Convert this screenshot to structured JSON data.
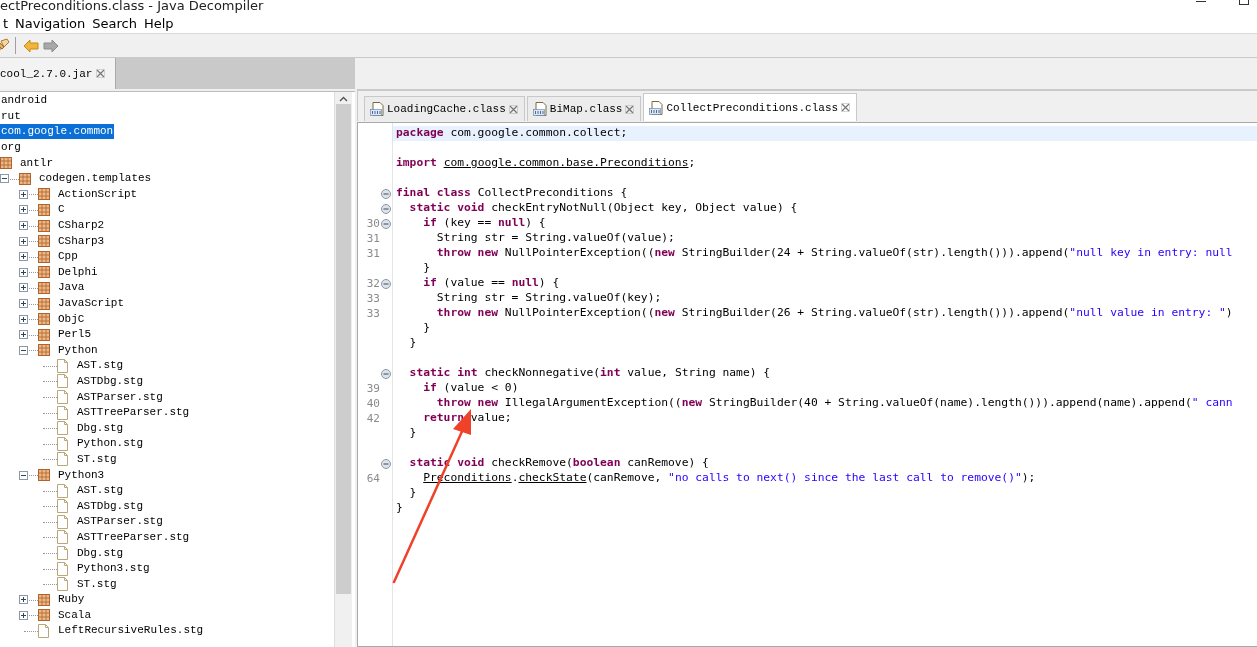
{
  "window": {
    "title": "ectPreconditions.class - Java Decompiler"
  },
  "menu": [
    "t",
    "Navigation",
    "Search",
    "Help"
  ],
  "toolbar": [
    {
      "kind": "open"
    },
    {
      "kind": "back",
      "disabled": false
    },
    {
      "kind": "forward",
      "disabled": true
    }
  ],
  "left_tabs": [
    {
      "label": "cool_2.7.0.jar",
      "selected": true
    }
  ],
  "tree": [
    {
      "label": "android",
      "selected": false
    },
    {
      "label": "rut",
      "selected": false
    },
    {
      "label": "com.google.common",
      "selected": true
    },
    {
      "label": "org",
      "selected": false,
      "children": [
        {
          "label": "antlr",
          "kind": "package",
          "selected": false,
          "children": [
            {
              "label": "codegen.templates",
              "kind": "package",
              "expanded": true,
              "selected": false,
              "children": [
                {
                  "label": "ActionScript",
                  "kind": "package",
                  "expanded": false,
                  "selected": false
                },
                {
                  "label": "C",
                  "kind": "package",
                  "expanded": false,
                  "selected": false
                },
                {
                  "label": "CSharp2",
                  "kind": "package",
                  "expanded": false,
                  "selected": false
                },
                {
                  "label": "CSharp3",
                  "kind": "package",
                  "expanded": false,
                  "selected": false
                },
                {
                  "label": "Cpp",
                  "kind": "package",
                  "expanded": false,
                  "selected": false
                },
                {
                  "label": "Delphi",
                  "kind": "package",
                  "expanded": false,
                  "selected": false
                },
                {
                  "label": "Java",
                  "kind": "package",
                  "expanded": false,
                  "selected": false
                },
                {
                  "label": "JavaScript",
                  "kind": "package",
                  "expanded": false,
                  "selected": false
                },
                {
                  "label": "ObjC",
                  "kind": "package",
                  "expanded": false,
                  "selected": false
                },
                {
                  "label": "Perl5",
                  "kind": "package",
                  "expanded": false,
                  "selected": false
                },
                {
                  "label": "Python",
                  "kind": "package",
                  "expanded": true,
                  "selected": false,
                  "children": [
                    {
                      "label": "AST.stg",
                      "kind": "file",
                      "selected": false
                    },
                    {
                      "label": "ASTDbg.stg",
                      "kind": "file",
                      "selected": false
                    },
                    {
                      "label": "ASTParser.stg",
                      "kind": "file",
                      "selected": false
                    },
                    {
                      "label": "ASTTreeParser.stg",
                      "kind": "file",
                      "selected": false
                    },
                    {
                      "label": "Dbg.stg",
                      "kind": "file",
                      "selected": false
                    },
                    {
                      "label": "Python.stg",
                      "kind": "file",
                      "selected": false
                    },
                    {
                      "label": "ST.stg",
                      "kind": "file",
                      "selected": false
                    }
                  ]
                },
                {
                  "label": "Python3",
                  "kind": "package",
                  "expanded": true,
                  "selected": false,
                  "children": [
                    {
                      "label": "AST.stg",
                      "kind": "file",
                      "selected": false
                    },
                    {
                      "label": "ASTDbg.stg",
                      "kind": "file",
                      "selected": false
                    },
                    {
                      "label": "ASTParser.stg",
                      "kind": "file",
                      "selected": false
                    },
                    {
                      "label": "ASTTreeParser.stg",
                      "kind": "file",
                      "selected": false
                    },
                    {
                      "label": "Dbg.stg",
                      "kind": "file",
                      "selected": false
                    },
                    {
                      "label": "Python3.stg",
                      "kind": "file",
                      "selected": false
                    },
                    {
                      "label": "ST.stg",
                      "kind": "file",
                      "selected": false
                    }
                  ]
                },
                {
                  "label": "Ruby",
                  "kind": "package",
                  "expanded": false,
                  "selected": false
                },
                {
                  "label": "Scala",
                  "kind": "package",
                  "expanded": false,
                  "selected": false
                },
                {
                  "label": "LeftRecursiveRules.stg",
                  "kind": "file",
                  "selected": false
                }
              ]
            }
          ]
        }
      ]
    }
  ],
  "editor_tabs": [
    {
      "label": "LoadingCache.class",
      "selected": false
    },
    {
      "label": "BiMap.class",
      "selected": false
    },
    {
      "label": "CollectPreconditions.class",
      "selected": true
    }
  ],
  "code": [
    {
      "highlighted": true,
      "segments": [
        {
          "kind": "keyword",
          "text": "package"
        },
        {
          "kind": "plain",
          "text": " com.google.common.collect;"
        }
      ]
    },
    {
      "blank_before": true,
      "segments": [
        {
          "kind": "keyword",
          "text": "import"
        },
        {
          "kind": "link",
          "text": " com.google.common.base.Preconditions"
        },
        {
          "kind": "plain",
          "text": ";"
        }
      ]
    },
    {
      "blank_before": true,
      "fold": true,
      "segments": [
        {
          "kind": "keyword",
          "text": "final class"
        },
        {
          "kind": "plain",
          "text": " CollectPreconditions {"
        }
      ]
    },
    {
      "fold": true,
      "segments": [
        {
          "kind": "keyword",
          "text": "  static void"
        },
        {
          "kind": "plain",
          "text": " checkEntryNotNull(Object key, Object value) {"
        }
      ]
    },
    {
      "number": "30",
      "fold": true,
      "segments": [
        {
          "kind": "keyword",
          "text": "    if"
        },
        {
          "kind": "plain",
          "text": " (key == "
        },
        {
          "kind": "keyword",
          "text": "null"
        },
        {
          "kind": "plain",
          "text": ") {"
        }
      ]
    },
    {
      "number": "31",
      "segments": [
        {
          "kind": "plain",
          "text": "      String str = String.valueOf(value);"
        }
      ]
    },
    {
      "number": "31",
      "segments": [
        {
          "kind": "keyword",
          "text": "      throw new"
        },
        {
          "kind": "plain",
          "text": " NullPointerException(("
        },
        {
          "kind": "keyword",
          "text": "new"
        },
        {
          "kind": "plain",
          "text": " StringBuilder(24 + String.valueOf(str).length())).append("
        },
        {
          "kind": "string",
          "text": "\"null key in entry: null"
        }
      ]
    },
    {
      "segments": [
        {
          "kind": "plain",
          "text": "    }"
        }
      ]
    },
    {
      "number": "32",
      "fold": true,
      "segments": [
        {
          "kind": "keyword",
          "text": "    if"
        },
        {
          "kind": "plain",
          "text": " (value == "
        },
        {
          "kind": "keyword",
          "text": "null"
        },
        {
          "kind": "plain",
          "text": ") {"
        }
      ]
    },
    {
      "number": "33",
      "segments": [
        {
          "kind": "plain",
          "text": "      String str = String.valueOf(key);"
        }
      ]
    },
    {
      "number": "33",
      "segments": [
        {
          "kind": "keyword",
          "text": "      throw new"
        },
        {
          "kind": "plain",
          "text": " NullPointerException(("
        },
        {
          "kind": "keyword",
          "text": "new"
        },
        {
          "kind": "plain",
          "text": " StringBuilder(26 + String.valueOf(str).length())).append("
        },
        {
          "kind": "string",
          "text": "\"null value in entry: \""
        },
        {
          "kind": "plain",
          "text": ")"
        }
      ]
    },
    {
      "segments": [
        {
          "kind": "plain",
          "text": "    }"
        }
      ]
    },
    {
      "segments": [
        {
          "kind": "plain",
          "text": "  }"
        }
      ]
    },
    {
      "blank_before": true,
      "fold": true,
      "segments": [
        {
          "kind": "keyword",
          "text": "  static int"
        },
        {
          "kind": "plain",
          "text": " checkNonnegative("
        },
        {
          "kind": "keyword",
          "text": "int"
        },
        {
          "kind": "plain",
          "text": " value, String name) {"
        }
      ]
    },
    {
      "number": "39",
      "segments": [
        {
          "kind": "keyword",
          "text": "    if"
        },
        {
          "kind": "plain",
          "text": " (value < 0)"
        }
      ]
    },
    {
      "number": "40",
      "segments": [
        {
          "kind": "keyword",
          "text": "      throw new"
        },
        {
          "kind": "plain",
          "text": " IllegalArgumentException(("
        },
        {
          "kind": "keyword",
          "text": "new"
        },
        {
          "kind": "plain",
          "text": " StringBuilder(40 + String.valueOf(name).length())).append(name).append("
        },
        {
          "kind": "string",
          "text": "\" cann"
        }
      ]
    },
    {
      "number": "42",
      "segments": [
        {
          "kind": "keyword",
          "text": "    return"
        },
        {
          "kind": "plain",
          "text": " value;"
        }
      ]
    },
    {
      "segments": [
        {
          "kind": "plain",
          "text": "  }"
        }
      ]
    },
    {
      "blank_before": true,
      "fold": true,
      "segments": [
        {
          "kind": "keyword",
          "text": "  static void"
        },
        {
          "kind": "plain",
          "text": " checkRemove("
        },
        {
          "kind": "keyword",
          "text": "boolean"
        },
        {
          "kind": "plain",
          "text": " canRemove) {"
        }
      ]
    },
    {
      "number": "64",
      "segments": [
        {
          "kind": "link",
          "text": "    Preconditions"
        },
        {
          "kind": "plain",
          "text": "."
        },
        {
          "kind": "link",
          "text": "checkState"
        },
        {
          "kind": "plain",
          "text": "(canRemove, "
        },
        {
          "kind": "string",
          "text": "\"no calls to next() since the last call to remove()\""
        },
        {
          "kind": "plain",
          "text": ");"
        }
      ]
    },
    {
      "segments": [
        {
          "kind": "plain",
          "text": "  }"
        }
      ]
    },
    {
      "segments": [
        {
          "kind": "plain",
          "text": "}"
        }
      ]
    }
  ],
  "annotation": {
    "kind": "arrow"
  }
}
